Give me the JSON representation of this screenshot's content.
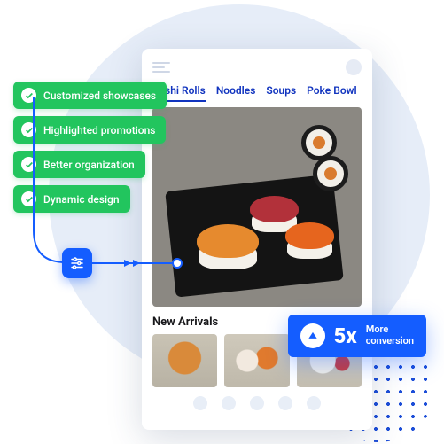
{
  "features": [
    "Customized showcases",
    "Highlighted promotions",
    "Better organization",
    "Dynamic design"
  ],
  "tabs": [
    "Sushi Rolls",
    "Noodles",
    "Soups",
    "Poke Bowl"
  ],
  "section": "New Arrivals",
  "badge": {
    "value": "5x",
    "line1": "More",
    "line2": "conversion"
  },
  "colors": {
    "accent": "#145dff",
    "success": "#22c55e"
  }
}
